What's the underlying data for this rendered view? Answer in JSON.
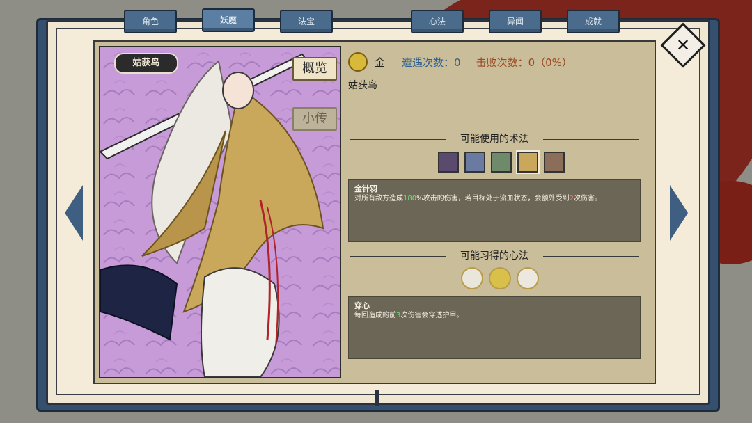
{
  "tabs": [
    "角色",
    "妖魔",
    "法宝",
    "心法",
    "异闻",
    "成就"
  ],
  "portrait": {
    "name": "姑获鸟",
    "overview_tab": "概览",
    "bio_tab": "小传"
  },
  "info": {
    "type": "金",
    "encounter_label": "遭遇次数：0",
    "defeat_label": "击败次数：0（0%）",
    "monster_name": "姑获鸟"
  },
  "spells": {
    "title": "可能使用的术法",
    "selected_name": "金针羽",
    "desc_before_1": "对所有敌方造成",
    "desc_num1": "180",
    "desc_mid": "%攻击的伤害，若目标处于流血状态，会额外受到",
    "desc_num2": "2",
    "desc_after": "次伤害。",
    "icons": [
      "spell-purple",
      "spell-spark",
      "spell-green",
      "spell-gold",
      "spell-brown"
    ]
  },
  "mind": {
    "title": "可能习得的心法",
    "selected_name": "穿心",
    "desc_before": "每回造成的前",
    "desc_num": "3",
    "desc_after": "次伤害会穿透护甲。",
    "icons": [
      "mind-arrows",
      "mind-heart",
      "mind-slash"
    ]
  },
  "colors": {
    "book_blue": "#35506e",
    "accent_gold": "#d9b93a",
    "encounter_blue": "#2b5f8f",
    "defeat_brown": "#9a4a22"
  }
}
